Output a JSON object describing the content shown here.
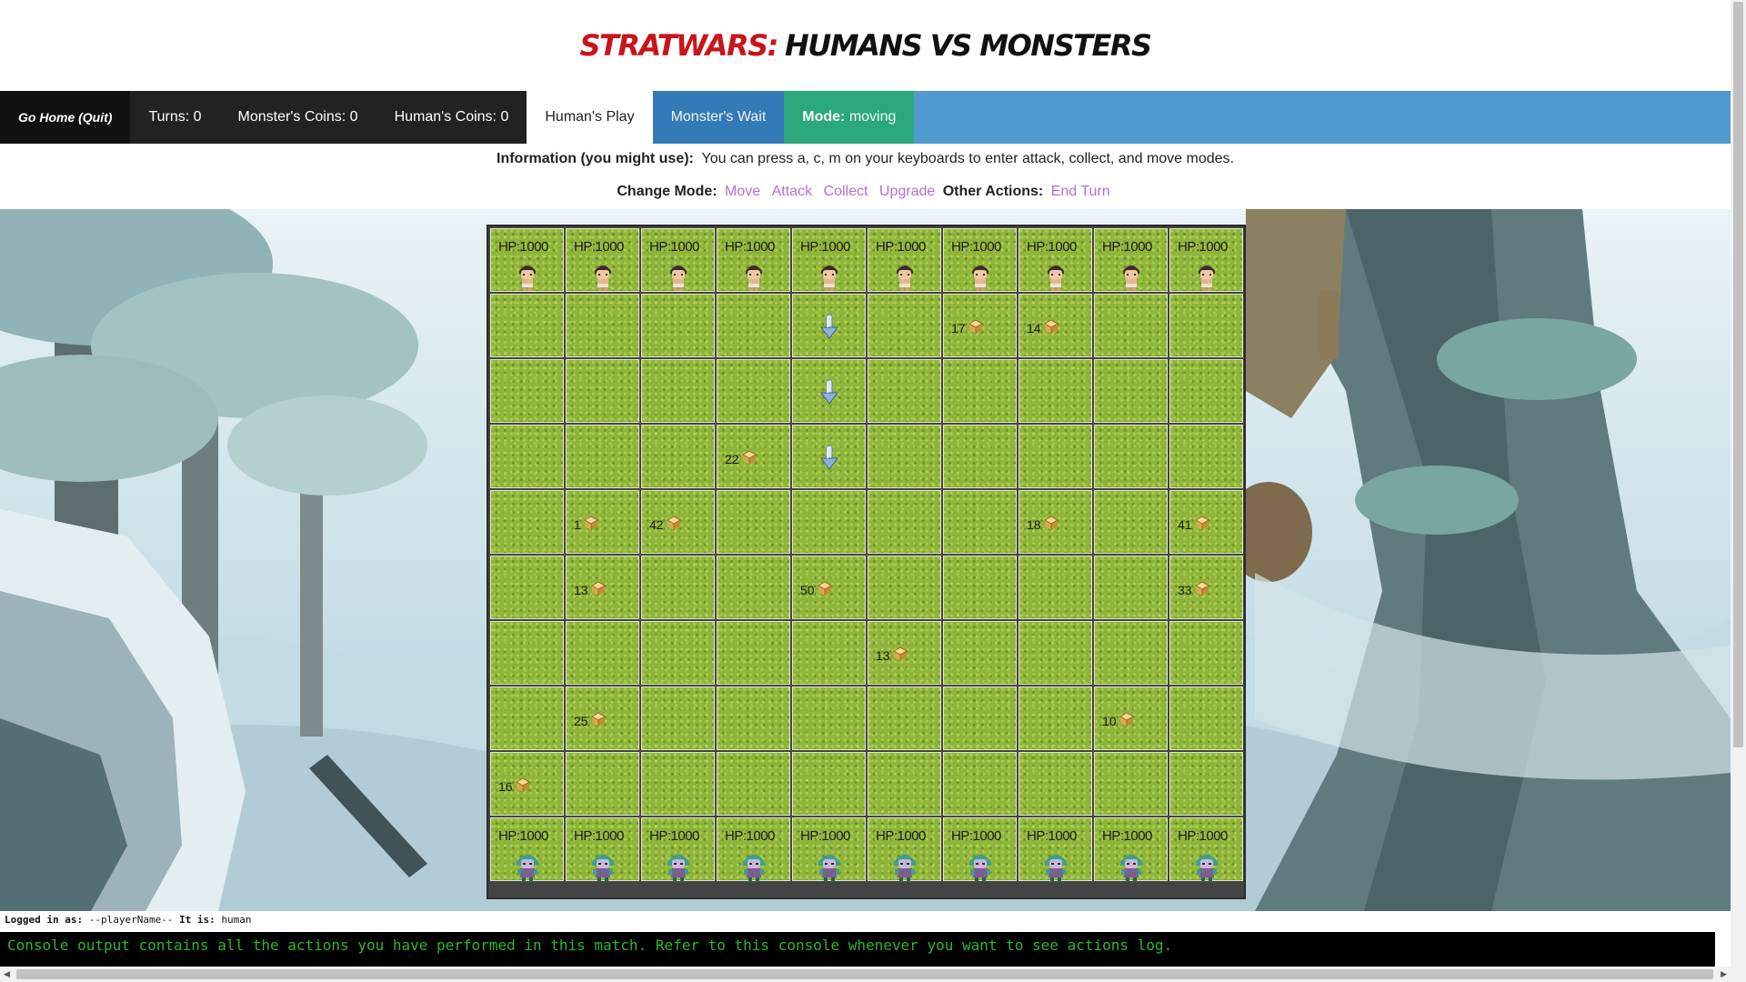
{
  "title": {
    "part1": "Stratwars:",
    "part2": "Humans vs Monsters"
  },
  "nav": {
    "quit": "Go Home (Quit)",
    "turns_label": "Turns:",
    "turns_value": "0",
    "monster_coins_label": "Monster's Coins:",
    "monster_coins_value": "0",
    "human_coins_label": "Human's Coins:",
    "human_coins_value": "0",
    "human_play": "Human's Play",
    "monster_wait": "Monster's Wait",
    "mode_label": "Mode:",
    "mode_value": "moving"
  },
  "info": {
    "label": "Information (you might use):",
    "text": "You can press a, c, m on your keyboards to enter attack, collect, and move modes."
  },
  "actions": {
    "change_mode_label": "Change Mode:",
    "move": "Move",
    "attack": "Attack",
    "collect": "Collect",
    "upgrade": "Upgrade",
    "other_label": "Other Actions:",
    "end_turn": "End Turn"
  },
  "board": {
    "rows": 10,
    "cols": 10,
    "units": [
      {
        "row": 0,
        "col": 0,
        "type": "human",
        "hp": "HP:1000"
      },
      {
        "row": 0,
        "col": 1,
        "type": "human",
        "hp": "HP:1000"
      },
      {
        "row": 0,
        "col": 2,
        "type": "human",
        "hp": "HP:1000"
      },
      {
        "row": 0,
        "col": 3,
        "type": "human",
        "hp": "HP:1000"
      },
      {
        "row": 0,
        "col": 4,
        "type": "human",
        "hp": "HP:1000"
      },
      {
        "row": 0,
        "col": 5,
        "type": "human",
        "hp": "HP:1000"
      },
      {
        "row": 0,
        "col": 6,
        "type": "human",
        "hp": "HP:1000"
      },
      {
        "row": 0,
        "col": 7,
        "type": "human",
        "hp": "HP:1000"
      },
      {
        "row": 0,
        "col": 8,
        "type": "human",
        "hp": "HP:1000"
      },
      {
        "row": 0,
        "col": 9,
        "type": "human",
        "hp": "HP:1000"
      },
      {
        "row": 9,
        "col": 0,
        "type": "monster",
        "hp": "HP:1000"
      },
      {
        "row": 9,
        "col": 1,
        "type": "monster",
        "hp": "HP:1000"
      },
      {
        "row": 9,
        "col": 2,
        "type": "monster",
        "hp": "HP:1000"
      },
      {
        "row": 9,
        "col": 3,
        "type": "monster",
        "hp": "HP:1000"
      },
      {
        "row": 9,
        "col": 4,
        "type": "monster",
        "hp": "HP:1000"
      },
      {
        "row": 9,
        "col": 5,
        "type": "monster",
        "hp": "HP:1000"
      },
      {
        "row": 9,
        "col": 6,
        "type": "monster",
        "hp": "HP:1000"
      },
      {
        "row": 9,
        "col": 7,
        "type": "monster",
        "hp": "HP:1000"
      },
      {
        "row": 9,
        "col": 8,
        "type": "monster",
        "hp": "HP:1000"
      },
      {
        "row": 9,
        "col": 9,
        "type": "monster",
        "hp": "HP:1000"
      }
    ],
    "coins": [
      {
        "row": 1,
        "col": 6,
        "value": "17"
      },
      {
        "row": 1,
        "col": 7,
        "value": "14"
      },
      {
        "row": 3,
        "col": 3,
        "value": "22"
      },
      {
        "row": 4,
        "col": 1,
        "value": "1"
      },
      {
        "row": 4,
        "col": 2,
        "value": "42"
      },
      {
        "row": 4,
        "col": 7,
        "value": "18"
      },
      {
        "row": 4,
        "col": 9,
        "value": "41"
      },
      {
        "row": 5,
        "col": 1,
        "value": "13"
      },
      {
        "row": 5,
        "col": 4,
        "value": "50"
      },
      {
        "row": 5,
        "col": 9,
        "value": "33"
      },
      {
        "row": 6,
        "col": 5,
        "value": "13"
      },
      {
        "row": 7,
        "col": 1,
        "value": "25"
      },
      {
        "row": 7,
        "col": 8,
        "value": "10"
      },
      {
        "row": 8,
        "col": 0,
        "value": "16"
      }
    ],
    "move_arrows": [
      {
        "row": 1,
        "col": 4
      },
      {
        "row": 2,
        "col": 4
      },
      {
        "row": 3,
        "col": 4
      }
    ]
  },
  "status": {
    "logged_label": "Logged in as:",
    "player": "--playerName--",
    "it_is_label": "It is:",
    "side": "human"
  },
  "console": {
    "text": "Console output contains all the actions you have performed in this match. Refer to this console whenever you want to see actions log."
  }
}
